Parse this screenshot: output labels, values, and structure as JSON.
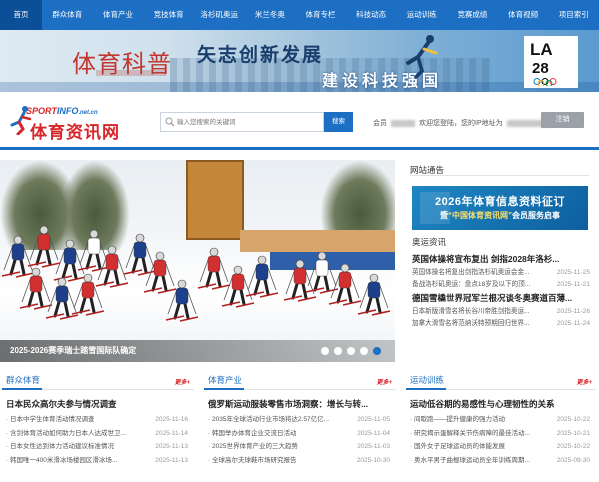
{
  "nav": {
    "items": [
      "首页",
      "群众体育",
      "体育产业",
      "竞技体育",
      "洛杉矶奥运",
      "米兰冬奥",
      "体育专栏",
      "科技动态",
      "运动训练",
      "竞赛成绩",
      "体育视频",
      "项目索引"
    ],
    "active_index": 0,
    "color": "#1d6fc3"
  },
  "banner": {
    "logo_text": "体育科普",
    "slogan_line1": "矢志创新发展",
    "slogan_line2": "建设科技强国",
    "la_text": "LA",
    "la_number": "28"
  },
  "header": {
    "brand_top": "SPORT",
    "brand_top_mid": "INFO",
    "brand_top_suffix": ".net.cn",
    "brand_cn": "体育资讯网",
    "search_placeholder": "输入您搜索的关键词",
    "search_button": "搜索",
    "member_label": "会员",
    "member_welcome": "欢迎您登陆，您的IP地址为",
    "logout_button": "注销"
  },
  "carousel": {
    "caption": "2025-2026赛季瑞士踏雪国际队确定",
    "dot_count": 5,
    "active_dot": 4
  },
  "notice": {
    "title": "网站通告",
    "image_line1": "2026年体育信息资料征订",
    "image_line2_prefix": "暨",
    "image_line2_highlight": "“中国体育资讯网”",
    "image_line2_suffix": "会员服务启事"
  },
  "olympic": {
    "title": "奥运资讯",
    "items": [
      {
        "type": "head",
        "text": "英国体操将宣布复出 剑指2028年洛杉..."
      },
      {
        "type": "row",
        "text": "英国体操名将复出剑指洛杉矶奥运会金...",
        "date": "2025-11-25"
      },
      {
        "type": "row",
        "text": "备战洛杉矶奥运：盘点18岁及以下的顶...",
        "date": "2025-11-21"
      },
      {
        "type": "head",
        "text": "德国雪橇世界冠军兰根况谈冬奥赛道百薄..."
      },
      {
        "type": "row",
        "text": "日本新版滑雪名将长谷川帝胜剑指奥运...",
        "date": "2025-11-26"
      },
      {
        "type": "row",
        "text": "加拿大滑雪名将范纳沃特预期回归世界...",
        "date": "2025-11-24"
      }
    ]
  },
  "columns": [
    {
      "title": "群众体育",
      "more": "更多+",
      "lead": "日本民众高尔夫参与情况调查",
      "rows": [
        {
          "text": "日本中学生体育活动情况调查",
          "date": "2025-11-16"
        },
        {
          "text": "含剑体育活动如何助力日本人达成世卫...",
          "date": "2025-11-14"
        },
        {
          "text": "日本女性达到体力活动建议标准情况",
          "date": "2025-11-13"
        },
        {
          "text": "韩国唯一400米滑冰场楼园区滑冰场...",
          "date": "2025-11-13"
        }
      ]
    },
    {
      "title": "体育产业",
      "more": "更多+",
      "lead": "俄罗斯运动服装零售市场洞察：增长与转...",
      "rows": [
        {
          "text": "2035年全球活动行业市场将达2.57亿亿...",
          "date": "2025-11-05"
        },
        {
          "text": "韩国举办体育企业交流日活动",
          "date": "2025-11-04"
        },
        {
          "text": "2025世界体育产业的三大趋势",
          "date": "2025-11-03"
        },
        {
          "text": "全球高尔夫球鞋市场研究报告",
          "date": "2025-10-30"
        }
      ]
    },
    {
      "title": "运动训练",
      "more": "更多+",
      "lead": "运动低谷期的易感性与心理韧性的关系",
      "rows": [
        {
          "text": "间歇跑——提升健康的强力活动",
          "date": "2025-10-22"
        },
        {
          "text": "研究揭示蛋解释关节伤病障的最佳活动...",
          "date": "2025-10-21"
        },
        {
          "text": "国外女子足球运动员的体能发展",
          "date": "2025-10-22"
        },
        {
          "text": "奥水平男子曲棍球运动员全年训练周期...",
          "date": "2025-09-30"
        }
      ]
    }
  ]
}
